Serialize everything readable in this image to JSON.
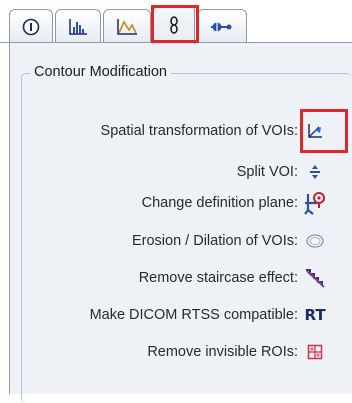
{
  "tabs": [
    {
      "icon": "info-icon",
      "selected": false
    },
    {
      "icon": "histogram-icon",
      "selected": false
    },
    {
      "icon": "curve-plot-icon",
      "selected": false
    },
    {
      "icon": "tools-icon",
      "selected": true,
      "highlighted": true
    },
    {
      "icon": "plugin-icon",
      "selected": false
    }
  ],
  "section": {
    "title": "Contour Modification"
  },
  "rows": [
    {
      "label": "Spatial transformation of VOIs:",
      "icon": "transform-icon",
      "highlighted": true
    },
    {
      "label": "Split VOI:",
      "icon": "split-icon"
    },
    {
      "label": "Change definition plane:",
      "icon": "plane-icon"
    },
    {
      "label": "Erosion / Dilation of VOIs:",
      "icon": "erosion-dilation-icon"
    },
    {
      "label": "Remove staircase effect:",
      "icon": "staircase-icon"
    },
    {
      "label": "Make DICOM RTSS compatible:",
      "icon": "rtss-icon",
      "icon_text": "RT"
    },
    {
      "label": "Remove invisible ROIs:",
      "icon": "remove-roi-icon"
    }
  ],
  "colors": {
    "highlight": "#e0262b",
    "panel": "#eef2f6",
    "accent_blue": "#2b4fa8"
  }
}
